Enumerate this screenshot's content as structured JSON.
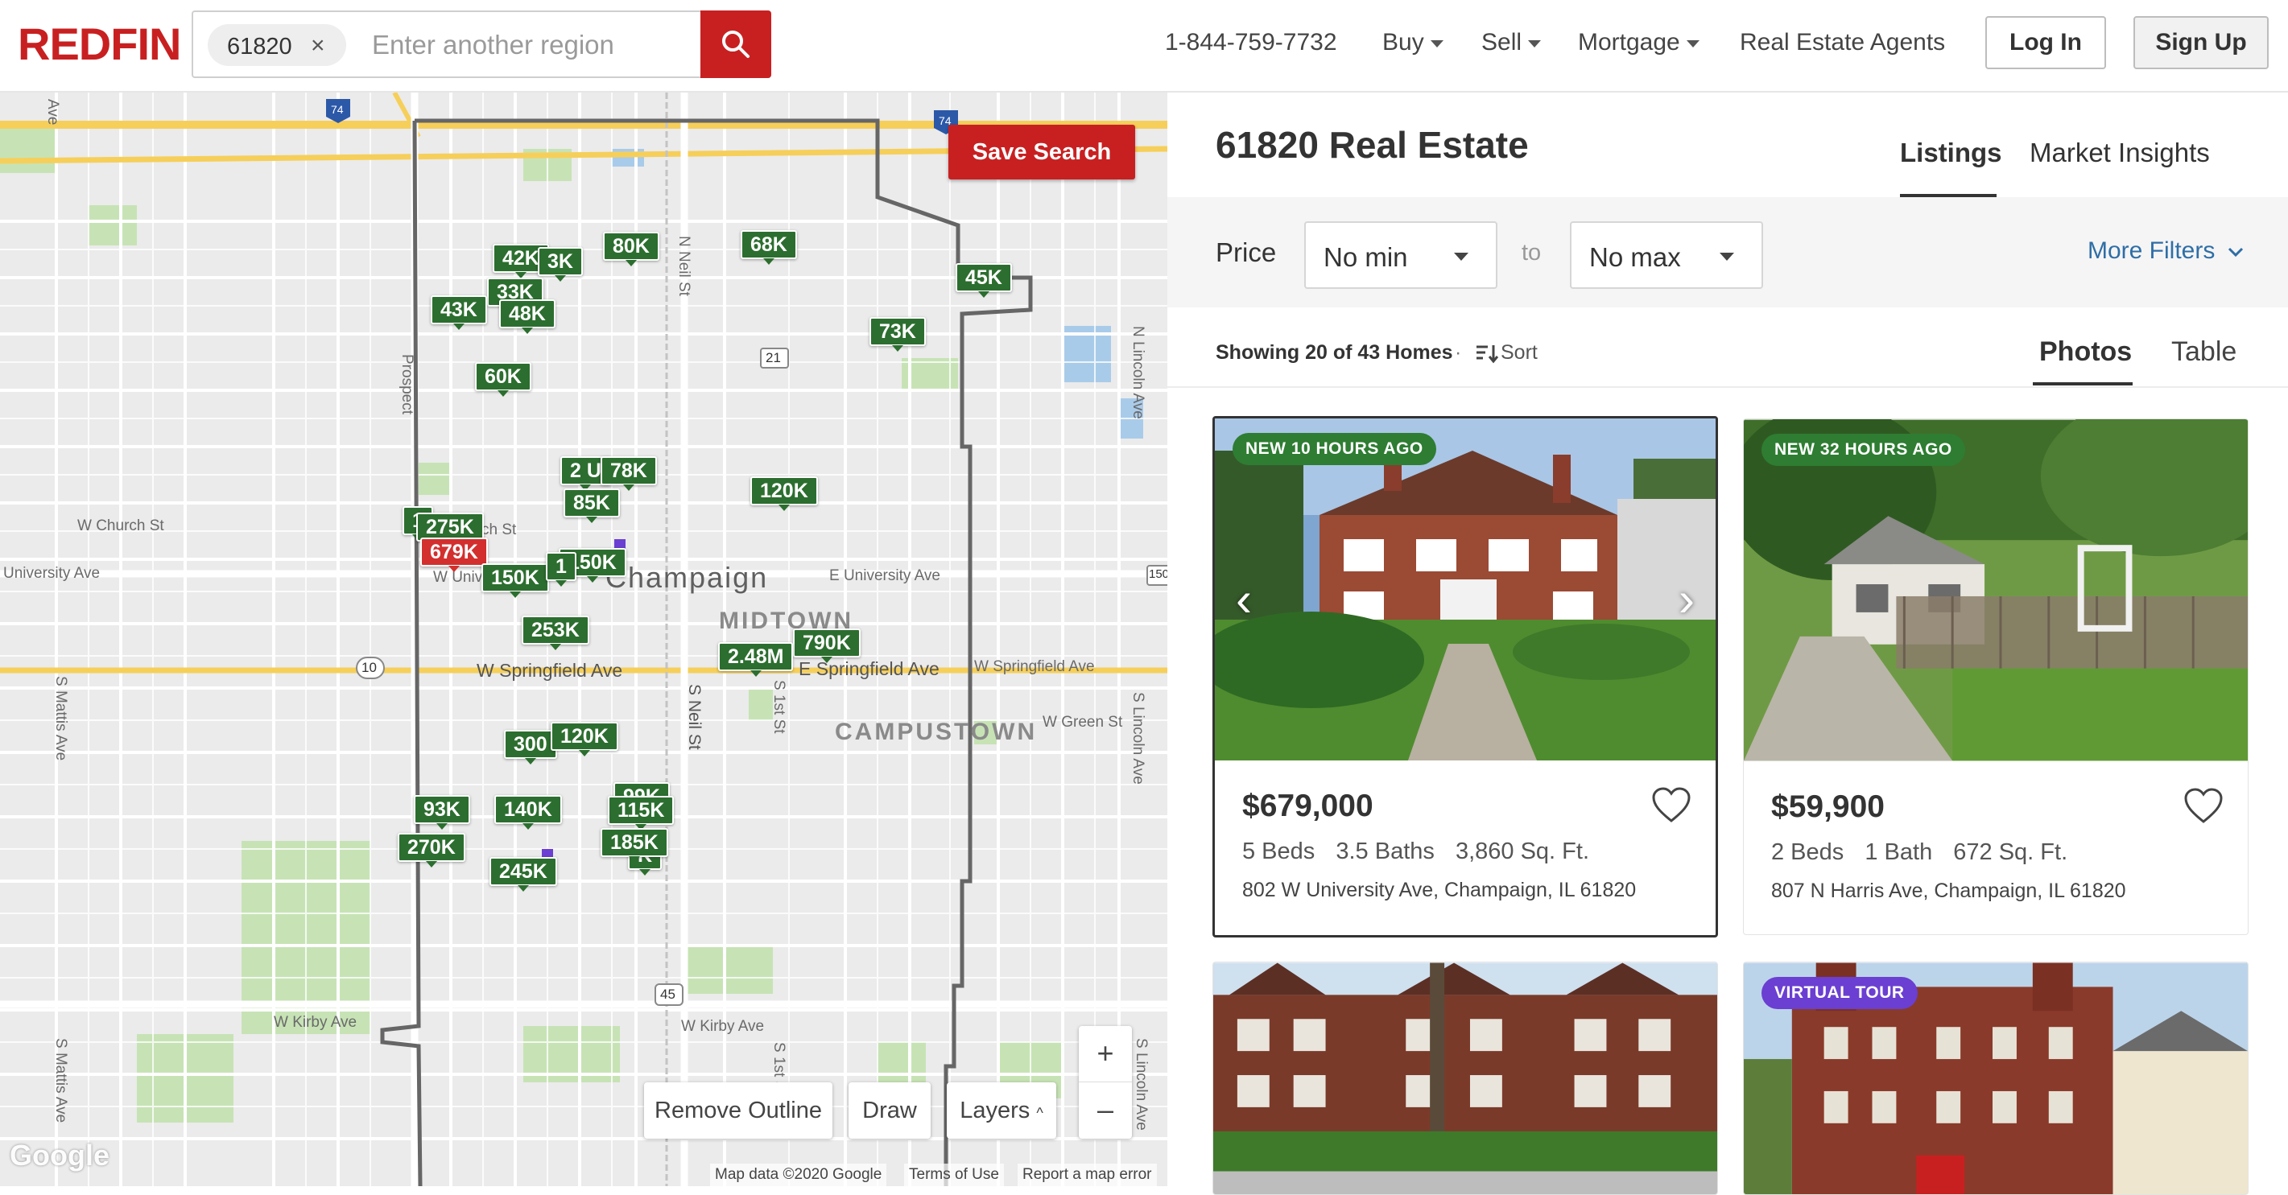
{
  "header": {
    "logo": "REDFIN",
    "search": {
      "chip": "61820",
      "placeholder": "Enter another region"
    },
    "phone": "1-844-759-7732",
    "nav": [
      "Buy",
      "Sell",
      "Mortgage"
    ],
    "agents": "Real Estate Agents",
    "login": "Log In",
    "signup": "Sign Up"
  },
  "map": {
    "save_search": "Save Search",
    "remove_outline": "Remove Outline",
    "draw": "Draw",
    "layers": "Layers",
    "layers_caret": "^",
    "zoom_in": "+",
    "zoom_out": "–",
    "google": "Google",
    "attribution": [
      "Map data ©2020 Google",
      "Terms of Use",
      "Report a map error"
    ],
    "pins": [
      "42K",
      "3K",
      "80K",
      "68K",
      "45K",
      "33K",
      "43K",
      "48K",
      "73K",
      "60K",
      "2 U",
      "78K",
      "120K",
      "85K",
      "1",
      "275K",
      "679K",
      "150K",
      "150K",
      "1",
      "253K",
      "790K",
      "2.48M",
      "300",
      "120K",
      "93K",
      "140K",
      "99K",
      "115K",
      "270K",
      "185K",
      "K",
      "245K"
    ],
    "labels": {
      "church": "W Church St",
      "university_w": "University Ave",
      "university_e": "E University Ave",
      "w_univ": "W Univ",
      "ch_st": "ch St",
      "champaign": "Champaign",
      "midtown": "MIDTOWN",
      "campustown": "CAMPUSTOWN",
      "springfield": "W Springfield Ave",
      "e_springfield": "E Springfield Ave",
      "w_springfield_e": "W Springfield Ave",
      "green": "W Green St",
      "kirby_w": "W Kirby Ave",
      "kirby_e": "W Kirby Ave",
      "neil": "S Neil St",
      "n_neil": "N Neil St",
      "mattis1": "S Mattis Ave",
      "mattis2": "S Mattis Ave",
      "lincoln_n": "N Lincoln Ave",
      "lincoln_s": "S Lincoln Ave",
      "lincoln_s2": "S Lincoln Ave",
      "first": "S 1st St",
      "first2": "S 1st St",
      "ave_top": "Ave",
      "prospect": "Prospect",
      "r74a": "74",
      "r74b": "74",
      "r21": "21",
      "r10": "10",
      "r45": "45",
      "r150": "150"
    }
  },
  "panel": {
    "title": "61820 Real Estate",
    "tabs": [
      "Listings",
      "Market Insights"
    ],
    "filters": {
      "price_label": "Price",
      "min": "No min",
      "to": "to",
      "max": "No max",
      "more": "More Filters"
    },
    "showing": "Showing 20 of 43 Homes",
    "dot": "·",
    "sort": "Sort",
    "views": [
      "Photos",
      "Table"
    ]
  },
  "listings": [
    {
      "badge": "NEW 10 HOURS AGO",
      "price": "$679,000",
      "beds": "5 Beds",
      "baths": "3.5 Baths",
      "sqft": "3,860 Sq. Ft.",
      "address": "802 W University Ave, Champaign, IL 61820"
    },
    {
      "badge": "NEW 32 HOURS AGO",
      "price": "$59,900",
      "beds": "2 Beds",
      "baths": "1 Bath",
      "sqft": "672 Sq. Ft.",
      "address": "807 N Harris Ave, Champaign, IL 61820"
    },
    {
      "badge": ""
    },
    {
      "badge": "VIRTUAL TOUR"
    }
  ],
  "colors": {
    "brand": "#c82021",
    "pin_green": "#2c6e2f",
    "pin_red": "#d32f2f",
    "link": "#2e6ea6",
    "badge_green": "#2e7d32",
    "badge_purple": "#6a3fd1"
  }
}
